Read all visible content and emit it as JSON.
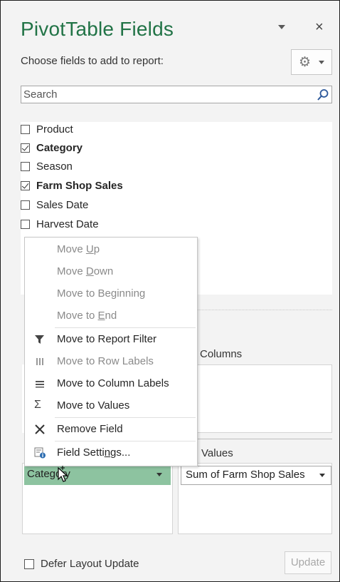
{
  "panel": {
    "title": "PivotTable Fields",
    "close_glyph": "×",
    "choose_label": "Choose fields to add to report:",
    "tools_icon": "gear-icon",
    "search_placeholder": "Search",
    "accent_color": "#217346"
  },
  "fields": [
    {
      "label": "Product",
      "checked": false,
      "bold": false
    },
    {
      "label": "Category",
      "checked": true,
      "bold": true
    },
    {
      "label": "Season",
      "checked": false,
      "bold": false
    },
    {
      "label": "Farm Shop Sales",
      "checked": true,
      "bold": true
    },
    {
      "label": "Sales Date",
      "checked": false,
      "bold": false
    },
    {
      "label": "Harvest Date",
      "checked": false,
      "bold": false
    }
  ],
  "areas": {
    "columns_label": "Columns",
    "values_label": "Values",
    "row_item": "Category",
    "values_item": "Sum of Farm Shop Sales"
  },
  "context_menu": {
    "items": [
      {
        "pre": "Move ",
        "u": "U",
        "post": "p",
        "enabled": false,
        "icon": ""
      },
      {
        "pre": "Move ",
        "u": "D",
        "post": "own",
        "enabled": false,
        "icon": ""
      },
      {
        "pre": "Move to Be",
        "u": "g",
        "post": "inning",
        "enabled": false,
        "icon": ""
      },
      {
        "pre": "Move to ",
        "u": "E",
        "post": "nd",
        "enabled": false,
        "icon": ""
      },
      {
        "pre": "Move to Report Filter",
        "u": "",
        "post": "",
        "enabled": true,
        "icon": "filter-icon"
      },
      {
        "pre": "Move to Row Labels",
        "u": "",
        "post": "",
        "enabled": false,
        "icon": "row-labels-icon"
      },
      {
        "pre": "Move to Column Labels",
        "u": "",
        "post": "",
        "enabled": true,
        "icon": "column-labels-icon"
      },
      {
        "pre": "Move to Values",
        "u": "",
        "post": "",
        "enabled": true,
        "icon": "sigma-icon"
      },
      {
        "pre": "Remove Field",
        "u": "",
        "post": "",
        "enabled": true,
        "icon": "remove-x-icon"
      },
      {
        "pre": "Field Setti",
        "u": "n",
        "post": "gs...",
        "enabled": true,
        "icon": "field-settings-icon"
      }
    ]
  },
  "footer": {
    "defer_label": "Defer Layout Update",
    "defer_checked": false,
    "update_label": "Update"
  }
}
